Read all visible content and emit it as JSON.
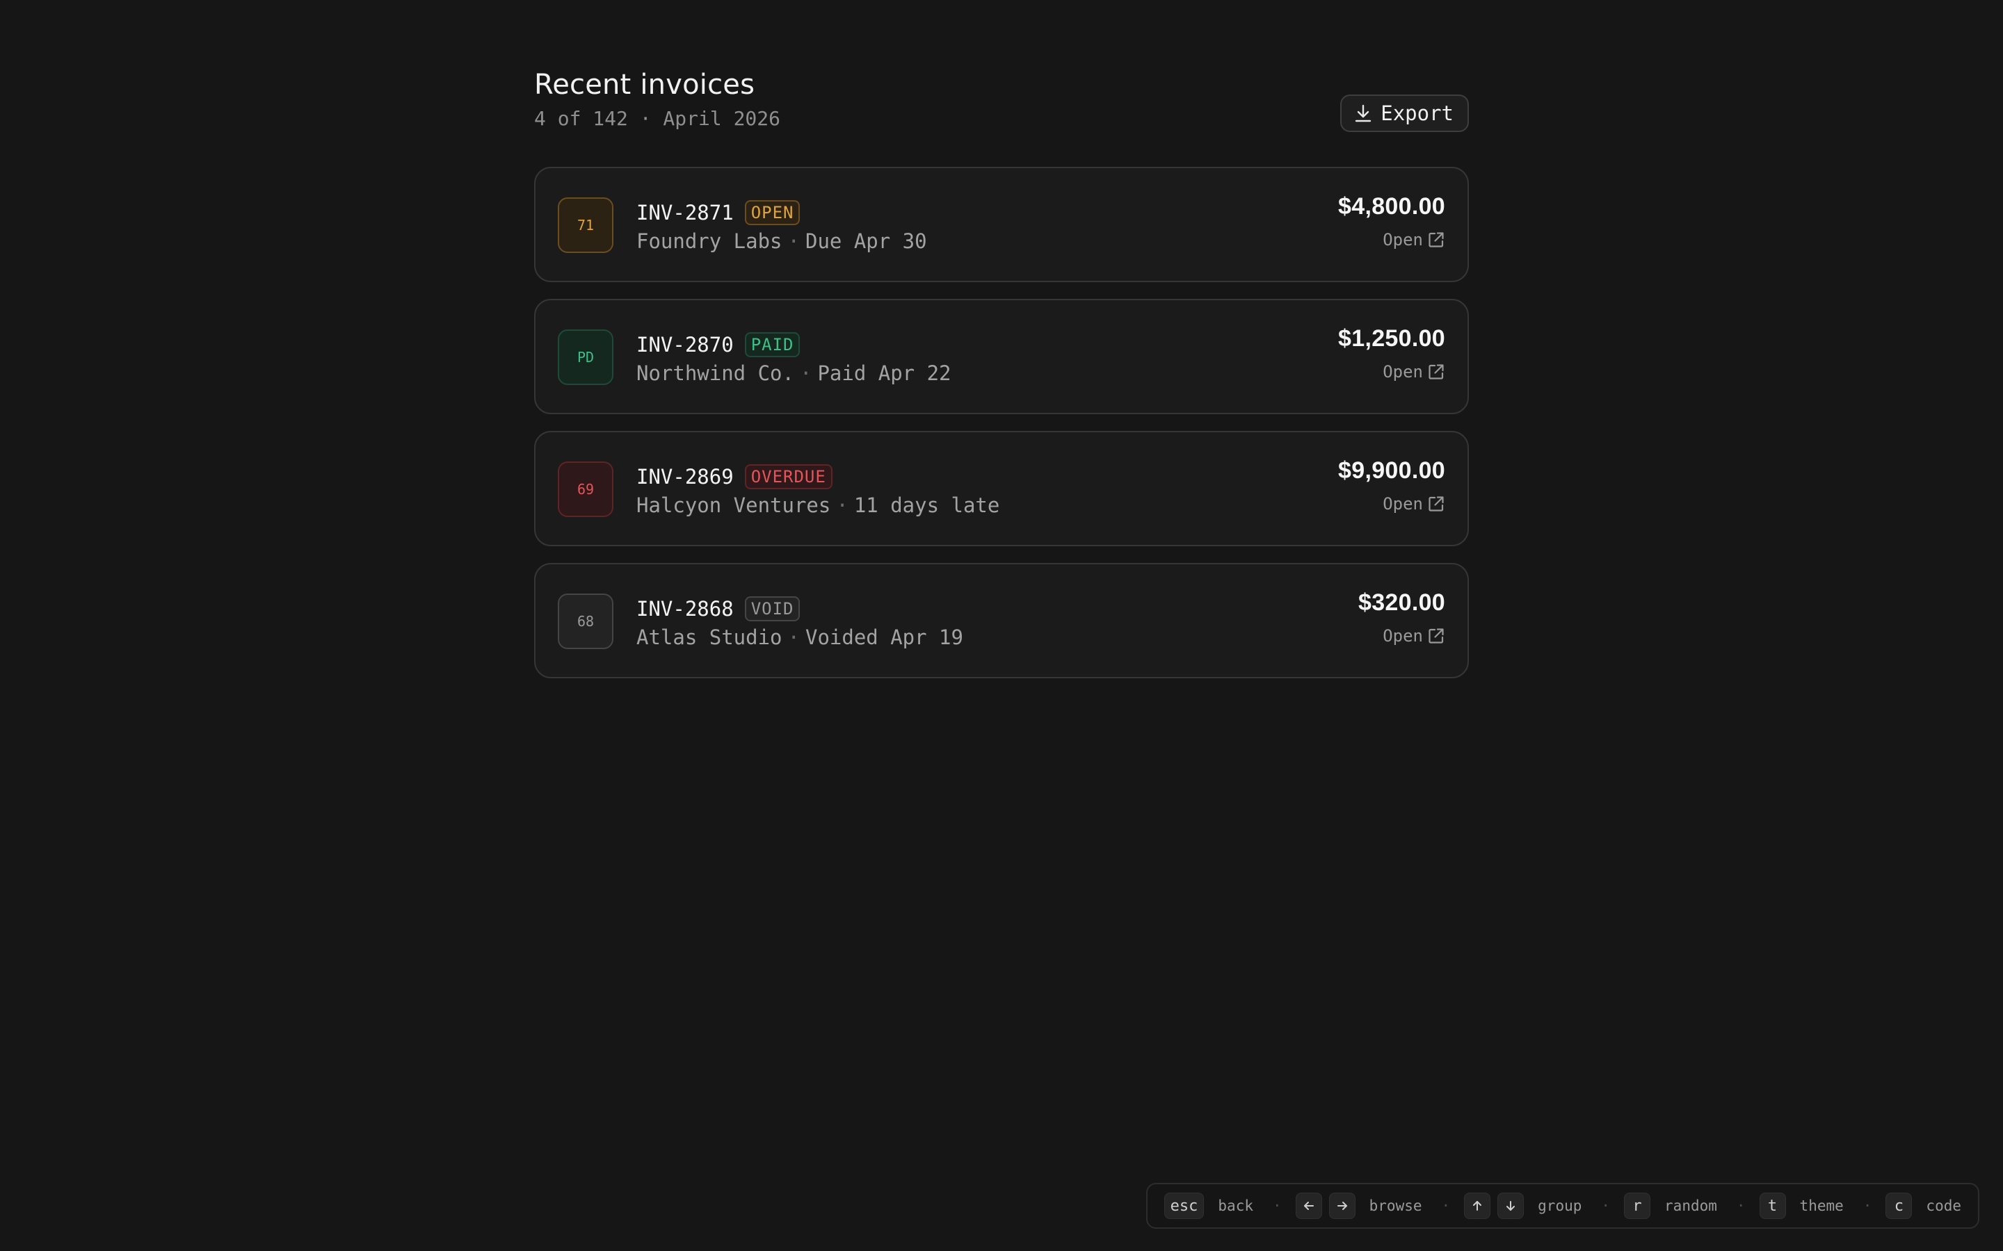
{
  "header": {
    "title": "Recent invoices",
    "subtitle": "4 of 142 · April 2026",
    "export_label": "Export"
  },
  "invoices": [
    {
      "avatar": "71",
      "id": "INV-2871",
      "status": "OPEN",
      "client": "Foundry Labs",
      "detail": "Due Apr 30",
      "amount": "$4,800.00",
      "link_label": "Open",
      "colors": {
        "text": "#e0a53a",
        "border": "#6a4e1f",
        "bg": "#2b2214"
      }
    },
    {
      "avatar": "PD",
      "id": "INV-2870",
      "status": "PAID",
      "client": "Northwind Co.",
      "detail": "Paid Apr 22",
      "amount": "$1,250.00",
      "link_label": "Open",
      "colors": {
        "text": "#3fbf88",
        "border": "#1f4a38",
        "bg": "#142820"
      }
    },
    {
      "avatar": "69",
      "id": "INV-2869",
      "status": "OVERDUE",
      "client": "Halcyon Ventures",
      "detail": "11 days late",
      "amount": "$9,900.00",
      "link_label": "Open",
      "colors": {
        "text": "#e5555a",
        "border": "#5e2426",
        "bg": "#2e1819"
      }
    },
    {
      "avatar": "68",
      "id": "INV-2868",
      "status": "VOID",
      "client": "Atlas Studio",
      "detail": "Voided Apr 19",
      "amount": "$320.00",
      "link_label": "Open",
      "colors": {
        "text": "#9a9a9a",
        "border": "#454545",
        "bg": "#232323"
      }
    }
  ],
  "shortcuts": {
    "esc_key": "esc",
    "back": "back",
    "browse": "browse",
    "group": "group",
    "r_key": "r",
    "random": "random",
    "t_key": "t",
    "theme": "theme",
    "c_key": "c",
    "code": "code"
  }
}
